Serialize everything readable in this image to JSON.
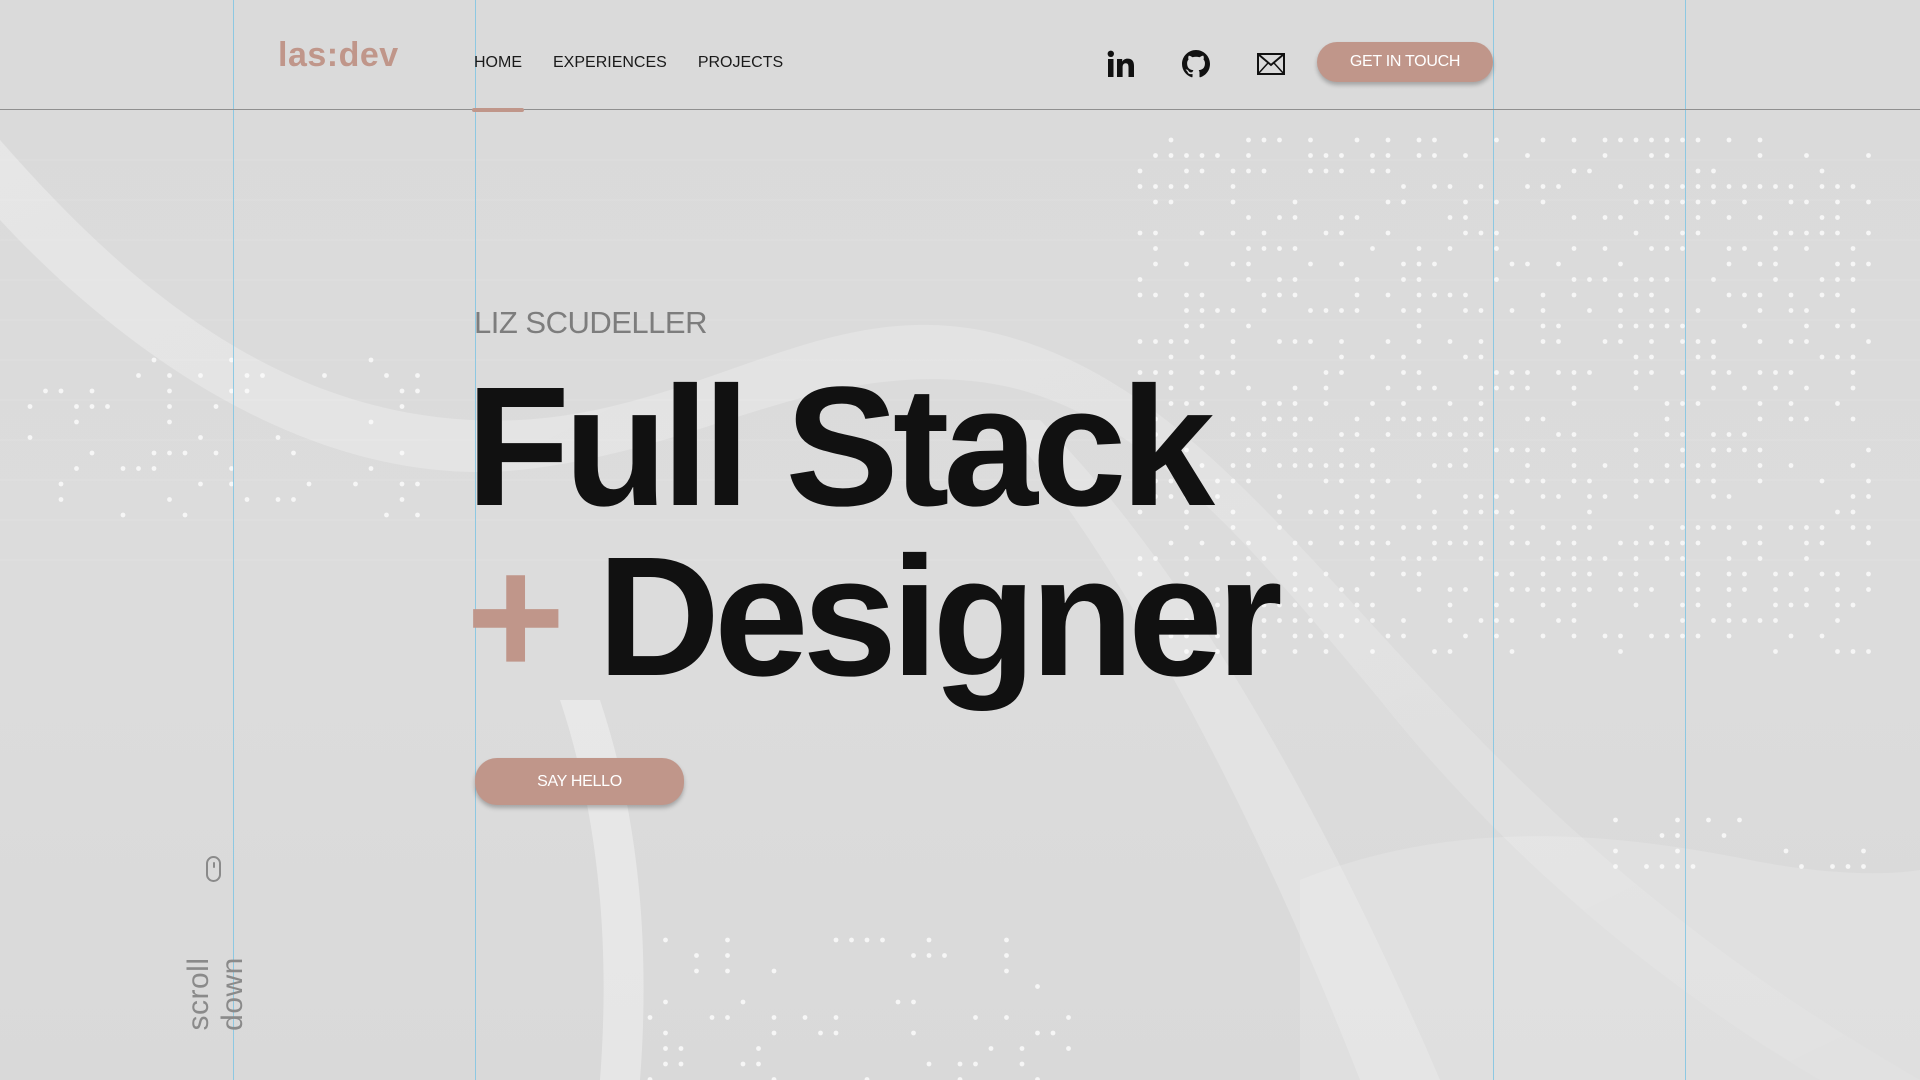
{
  "brand": {
    "logo": "las:dev",
    "accent_color": "#c0968a"
  },
  "nav": {
    "items": [
      {
        "label": "HOME",
        "active": true
      },
      {
        "label": "EXPERIENCES",
        "active": false
      },
      {
        "label": "PROJECTS",
        "active": false
      }
    ]
  },
  "social": {
    "icons": [
      "linkedin-icon",
      "github-icon",
      "mail-icon"
    ]
  },
  "header": {
    "cta_label": "GET IN TOUCH"
  },
  "hero": {
    "name": "LIZ SCUDELLER",
    "line1": "Full Stack",
    "plus": "+",
    "line2": "Designer",
    "button_label": "SAY HELLO"
  },
  "scroll": {
    "label": "scroll down"
  }
}
